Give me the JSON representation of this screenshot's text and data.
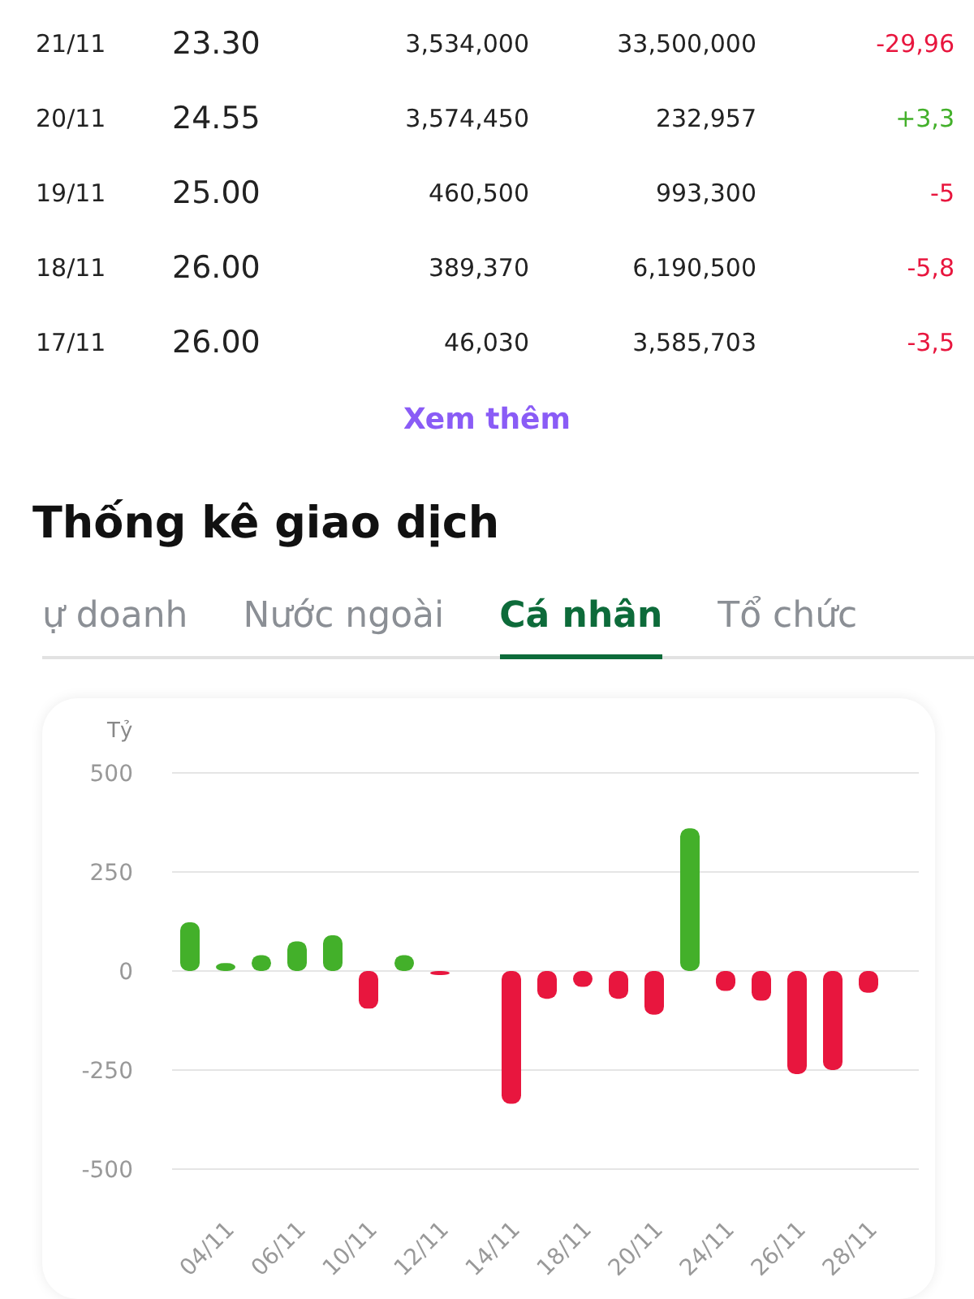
{
  "table": {
    "rows": [
      {
        "date": "21/11",
        "price": "23.30",
        "volume_1": "3,534,000",
        "volume_2": "33,500,000",
        "change": "-29,96",
        "color": "#e8163e"
      },
      {
        "date": "20/11",
        "price": "24.55",
        "volume_1": "3,574,450",
        "volume_2": "232,957",
        "change": "+3,3",
        "color": "#43b02a"
      },
      {
        "date": "19/11",
        "price": "25.00",
        "volume_1": "460,500",
        "volume_2": "993,300",
        "change": "-5",
        "color": "#e8163e"
      },
      {
        "date": "18/11",
        "price": "26.00",
        "volume_1": "389,370",
        "volume_2": "6,190,500",
        "change": "-5,8",
        "color": "#e8163e"
      },
      {
        "date": "17/11",
        "price": "26.00",
        "volume_1": "46,030",
        "volume_2": "3,585,703",
        "change": "-3,5",
        "color": "#e8163e"
      }
    ]
  },
  "more_link": "Xem thêm",
  "section_title": "Thống kê giao dịch",
  "tabs": [
    {
      "label": "ự doanh",
      "selected": false
    },
    {
      "label": "Nước ngoài",
      "selected": false
    },
    {
      "label": "Cá nhân",
      "selected": true
    },
    {
      "label": "Tổ chức",
      "selected": false
    }
  ],
  "chart": {
    "chart_data": {
      "type": "bar",
      "ylabel": "Tỷ",
      "categories": [
        null,
        "04/11",
        null,
        "06/11",
        null,
        "10/11",
        null,
        "12/11",
        null,
        "14/11",
        null,
        "18/11",
        null,
        "20/11",
        null,
        "24/11",
        null,
        "26/11",
        null,
        "28/11"
      ],
      "series": [
        {
          "color": "#43b02a",
          "values": [
            123,
            20,
            40,
            75,
            90,
            null,
            40,
            null,
            null,
            null,
            null,
            null,
            null,
            null,
            360,
            null,
            null,
            null,
            null,
            null
          ]
        },
        {
          "color": "#e8163e",
          "values": [
            null,
            null,
            null,
            null,
            null,
            -95,
            null,
            -10,
            null,
            -335,
            -70,
            -40,
            -70,
            -110,
            null,
            -50,
            -75,
            -260,
            -250,
            -55
          ]
        }
      ],
      "grid": true,
      "ylim": [
        -500,
        500
      ],
      "yticks": [
        500,
        250,
        0,
        -250,
        -500
      ]
    }
  }
}
